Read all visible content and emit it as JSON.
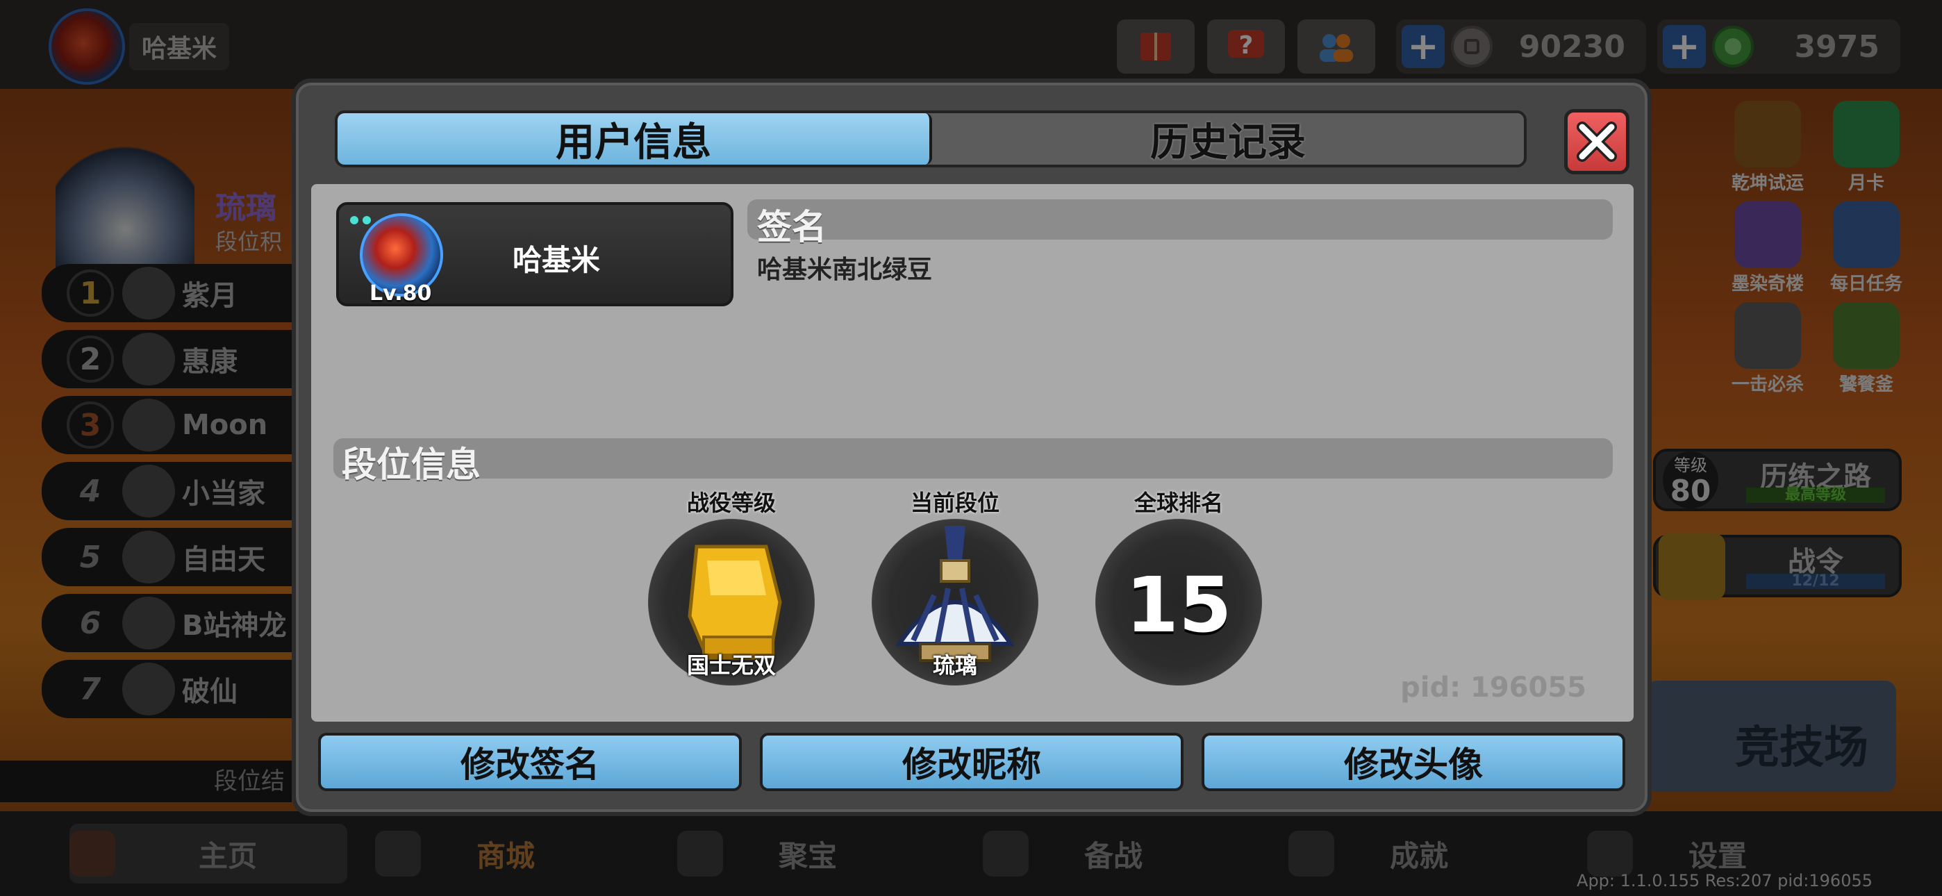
{
  "topbar": {
    "username": "哈基米",
    "currency_coin": "90230",
    "currency_gem": "3975"
  },
  "leaderboard": {
    "rank_name": "琉璃",
    "rank_sub": "段位积",
    "rows": [
      {
        "num": "1",
        "name": "紫月"
      },
      {
        "num": "2",
        "name": "惠康"
      },
      {
        "num": "3",
        "name": "Moon"
      },
      {
        "num": "4",
        "name": "小当家"
      },
      {
        "num": "5",
        "name": "自由天"
      },
      {
        "num": "6",
        "name": "B站神龙"
      },
      {
        "num": "7",
        "name": "破仙"
      }
    ],
    "footer": "段位结"
  },
  "right_side": {
    "icons": [
      {
        "label": "乾坤试运"
      },
      {
        "label": "月卡"
      },
      {
        "label": "墨染奇楼"
      },
      {
        "label": "每日任务"
      },
      {
        "label": "一击必杀"
      },
      {
        "label": "饕餮釜"
      }
    ],
    "level_card": {
      "level_label": "等级",
      "level": "80",
      "title": "历练之路",
      "sub": "最高等级"
    },
    "pass_card": {
      "title": "战令",
      "progress": "12/12"
    },
    "arena": "竞技场"
  },
  "bottom_nav": [
    {
      "label": "主页"
    },
    {
      "label": "商城"
    },
    {
      "label": "聚宝"
    },
    {
      "label": "备战"
    },
    {
      "label": "成就"
    },
    {
      "label": "设置"
    }
  ],
  "version_text": "App: 1.1.0.155 Res:207 pid:196055",
  "dialog": {
    "tabs": [
      {
        "label": "用户信息",
        "active": true
      },
      {
        "label": "历史记录",
        "active": false
      }
    ],
    "user": {
      "name": "哈基米",
      "level": "Lv.80"
    },
    "signature_title": "签名",
    "signature_text": "哈基米南北绿豆",
    "rank_section_title": "段位信息",
    "stats": [
      {
        "label": "战役等级",
        "caption": "国士无双"
      },
      {
        "label": "当前段位",
        "caption": "琉璃"
      },
      {
        "label": "全球排名",
        "value": "15"
      }
    ],
    "pid": "pid: 196055",
    "buttons": [
      {
        "label": "修改签名"
      },
      {
        "label": "修改昵称"
      },
      {
        "label": "修改头像"
      }
    ]
  },
  "colors": {
    "tab_active": "#7fc2e8",
    "button_blue": "#6eb4dd",
    "close_red": "#e04848",
    "panel_gray": "#a9a9a9"
  }
}
